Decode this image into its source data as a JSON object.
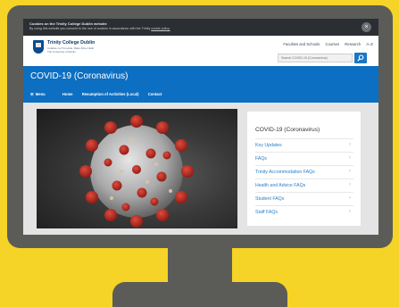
{
  "cookie_bar": {
    "title": "Cookies on the Trinity College Dublin website",
    "message": "By using this website you consent to the use of cookies in accordance with the Trinity ",
    "link": "cookie policy.",
    "close_icon": "close-icon"
  },
  "header": {
    "college_name": "Trinity College Dublin",
    "subtitle_line1": "Coláiste na Tríonóide, Baile Átha Cliath",
    "subtitle_line2": "The University of Dublin",
    "top_links": [
      "Faculties and Schools",
      "Courses",
      "Research",
      "A–Z"
    ],
    "search_placeholder": "Search COVID-19 (Coronavirus)",
    "search_icon": "search-icon"
  },
  "banner": {
    "title": "COVID-19 (Coronavirus)",
    "nav": [
      "Menu",
      "Home",
      "Resumption of Activities (Local)",
      "Contact"
    ]
  },
  "sidebar": {
    "title": "COVID-19 (Coronavirus)",
    "items": [
      "Key Updates",
      "FAQs",
      "Trinity Accommodation FAQs",
      "Health and Advice FAQs",
      "Student FAQs",
      "Staff FAQs"
    ]
  },
  "colors": {
    "background": "#f5d327",
    "monitor": "#5b5c58",
    "banner": "#0d6fc1",
    "link": "#2a7fc7",
    "cookie_bar": "#2b2e32"
  }
}
